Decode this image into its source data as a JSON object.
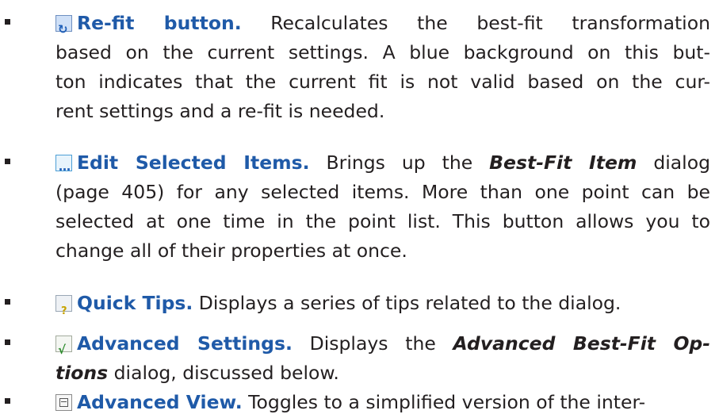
{
  "items": [
    {
      "icon": "refit-icon",
      "heading": "Re-fit button.",
      "lines": [
        " Recalculates the best-fit transformation",
        "based on the current settings. A blue background on this but-",
        "ton indicates that the current fit is not valid based on the cur-",
        "rent settings and a re-fit is needed."
      ]
    },
    {
      "icon": "edit-selected-items-icon",
      "heading": "Edit Selected Items.",
      "line1_pre": " Brings up the ",
      "line1_em": "Best-Fit Item",
      "line1_post": " dialog",
      "lines": [
        "(page 405) for any selected items. More than one point can be",
        "selected at one time in the point list. This button allows you to",
        "change all of their properties at once."
      ]
    },
    {
      "icon": "quick-tips-icon",
      "heading": "Quick Tips.",
      "text": " Displays a series of tips related to the dialog."
    },
    {
      "icon": "advanced-settings-icon",
      "heading": "Advanced Settings.",
      "line1_pre": " Displays the ",
      "line1_em": "Advanced Best-Fit Op-",
      "line2_em": "tions",
      "line2_post": " dialog, discussed below."
    },
    {
      "icon": "advanced-view-icon",
      "heading": "Advanced View.",
      "text": " Toggles to a simplified version of the inter-"
    }
  ]
}
